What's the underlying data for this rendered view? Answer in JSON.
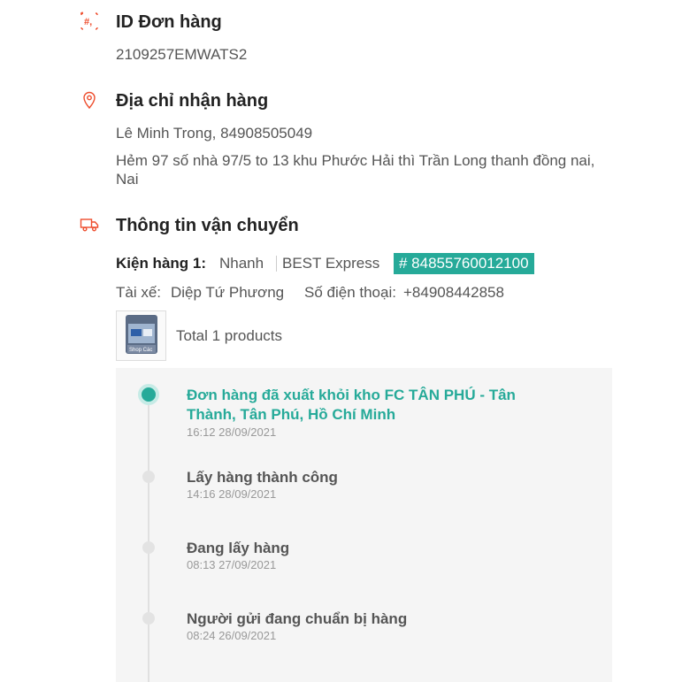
{
  "order_id": {
    "icon": "order-number-icon",
    "title": "ID Đơn hàng",
    "value": "2109257EMWATS2"
  },
  "address": {
    "icon": "location-pin-icon",
    "title": "Địa chỉ nhận hàng",
    "recipient": "Lê Minh Trong, 84908505049",
    "line1": "Hẻm 97 số nhà 97/5 to 13 khu Phước Hải thì Trần Long thanh đồng nai,",
    "line2": "Nai"
  },
  "shipping": {
    "icon": "truck-icon",
    "title": "Thông tin vận chuyển",
    "package_label": "Kiện hàng 1:",
    "speed": "Nhanh",
    "carrier": "BEST Express",
    "tracking": "# 84855760012100",
    "driver_label": "Tài xế:",
    "driver_name": "Diệp Tứ Phương",
    "phone_label": "Số điện thoại:",
    "phone": "+84908442858",
    "products_summary": "Total 1 products",
    "thumb_text": "Shop Các"
  },
  "timeline": [
    {
      "title_line1": "Đơn hàng đã xuất khỏi kho FC TÂN PHÚ - Tân",
      "title_line2": "Thành, Tân Phú, Hồ Chí Minh",
      "time": "16:12 28/09/2021",
      "active": true
    },
    {
      "title": "Lấy hàng thành công",
      "time": "14:16 28/09/2021",
      "active": false
    },
    {
      "title": "Đang lấy hàng",
      "time": "08:13 27/09/2021",
      "active": false
    },
    {
      "title": "Người gửi đang chuẩn bị hàng",
      "time": "08:24 26/09/2021",
      "active": false
    }
  ],
  "colors": {
    "accent": "#26aa99",
    "icon": "#ee4d2d"
  }
}
